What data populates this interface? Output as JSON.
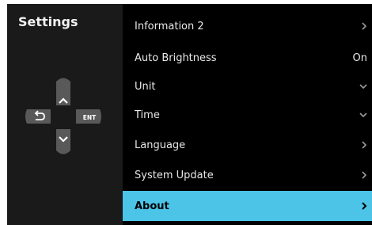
{
  "header": {
    "title": "Settings"
  },
  "dpad": {
    "enter_label": "ENT",
    "back_icon": "back-arrow-icon",
    "up_icon": "chevron-up-icon",
    "down_icon": "chevron-down-icon"
  },
  "menu": {
    "items": [
      {
        "label": "Information 2",
        "trailing": "chevron-right-icon"
      },
      {
        "label": "Auto Brightness",
        "value": "On"
      },
      {
        "label": "Unit",
        "trailing": "chevron-down-icon"
      },
      {
        "label": "Time",
        "trailing": "chevron-down-icon"
      },
      {
        "label": "Language",
        "trailing": "chevron-right-icon"
      },
      {
        "label": "System Update",
        "trailing": "chevron-right-icon"
      },
      {
        "label": "About",
        "trailing": "chevron-right-icon",
        "selected": true
      }
    ]
  },
  "colors": {
    "accent": "#4cc4e8",
    "screen_bg": "#000000",
    "panel_bg": "#1a1a1a",
    "button_bg": "#595959"
  }
}
